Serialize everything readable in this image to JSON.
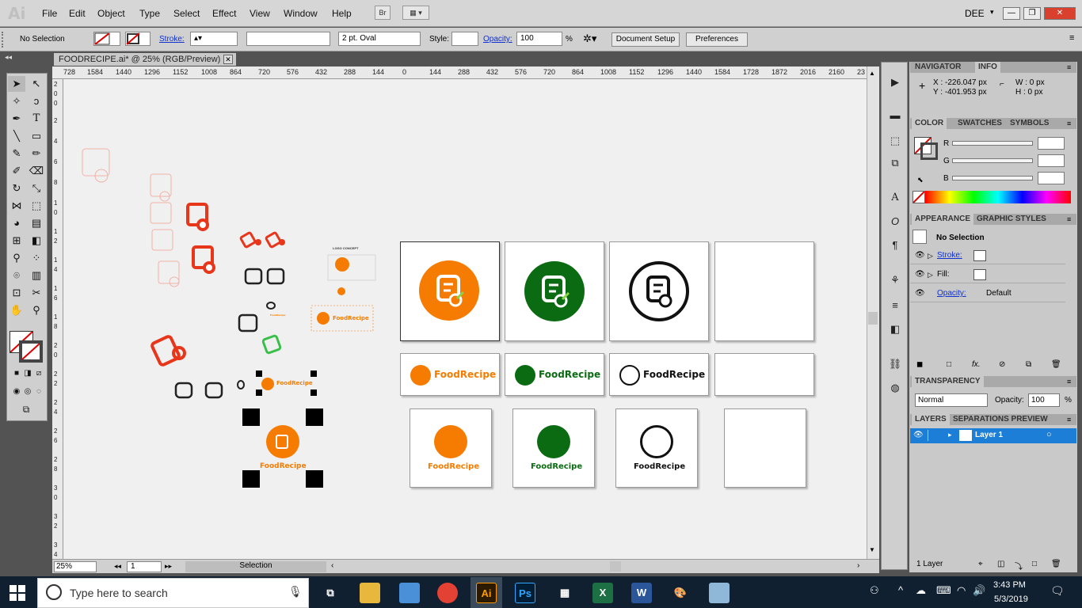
{
  "app": {
    "logo": "Ai",
    "workspace": "DEE"
  },
  "menu": [
    "File",
    "Edit",
    "Object",
    "Type",
    "Select",
    "Effect",
    "View",
    "Window",
    "Help"
  ],
  "menu_buttons": {
    "bridge": "Br"
  },
  "control": {
    "selection": "No Selection",
    "stroke_label": "Stroke:",
    "brush": "2 pt. Oval",
    "style_label": "Style:",
    "opacity_label": "Opacity:",
    "opacity_value": "100",
    "opacity_unit": "%",
    "document_setup": "Document Setup",
    "preferences": "Preferences"
  },
  "document": {
    "tab": "FOODRECIPE.ai* @ 25% (RGB/Preview)",
    "close": "✕"
  },
  "ruler": {
    "h": [
      "728",
      "1584",
      "1440",
      "1296",
      "1152",
      "1008",
      "864",
      "720",
      "576",
      "432",
      "288",
      "144",
      "0",
      "144",
      "288",
      "432",
      "576",
      "720",
      "864",
      "1008",
      "1152",
      "1296",
      "1440",
      "1584",
      "1728",
      "1872",
      "2016",
      "2160",
      "23"
    ],
    "v": [
      "2",
      "0",
      "0",
      "2",
      "4",
      "6",
      "8",
      "1",
      "0",
      "1",
      "2",
      "1",
      "4",
      "1",
      "6",
      "1",
      "8",
      "2",
      "0",
      "2",
      "2",
      "2",
      "4",
      "2",
      "6",
      "2",
      "8",
      "3",
      "0",
      "3",
      "2",
      "3",
      "4"
    ]
  },
  "status": {
    "zoom": "25%",
    "artboard": "1",
    "tool": "Selection"
  },
  "navigator": {
    "tab1": "NAVIGATOR",
    "tab2": "INFO",
    "x": "X : -226.047 px",
    "y": "Y : -401.953 px",
    "w": "W : 0 px",
    "h": "H : 0 px"
  },
  "color": {
    "tabs": [
      "COLOR",
      "SWATCHES",
      "SYMBOLS"
    ],
    "r": "R",
    "g": "G",
    "b": "B"
  },
  "appearance": {
    "tabs": [
      "APPEARANCE",
      "GRAPHIC STYLES"
    ],
    "selection": "No Selection",
    "stroke": "Stroke:",
    "fill": "Fill:",
    "opacity": "Opacity:",
    "opacity_value": "Default"
  },
  "transparency": {
    "title": "TRANSPARENCY",
    "mode": "Normal",
    "opacity_label": "Opacity:",
    "opacity_value": "100",
    "unit": "%"
  },
  "layers": {
    "tabs": [
      "LAYERS",
      "SEPARATIONS PREVIEW"
    ],
    "layer": "Layer 1",
    "count": "1 Layer"
  },
  "artwork": {
    "brand": "FoodRecipe",
    "concept_title": "LOGO CONCEPT"
  },
  "taskbar": {
    "search": "Type here to search",
    "time": "3:43 PM",
    "date": "5/3/2019",
    "ai": "Ai",
    "ps": "Ps",
    "word": "W"
  },
  "colors": {
    "orange": "#f57c00",
    "green": "#0b6b12",
    "red": "#e8361b",
    "light_green": "#3ac04a",
    "selection_blue": "#1c7ed6"
  }
}
